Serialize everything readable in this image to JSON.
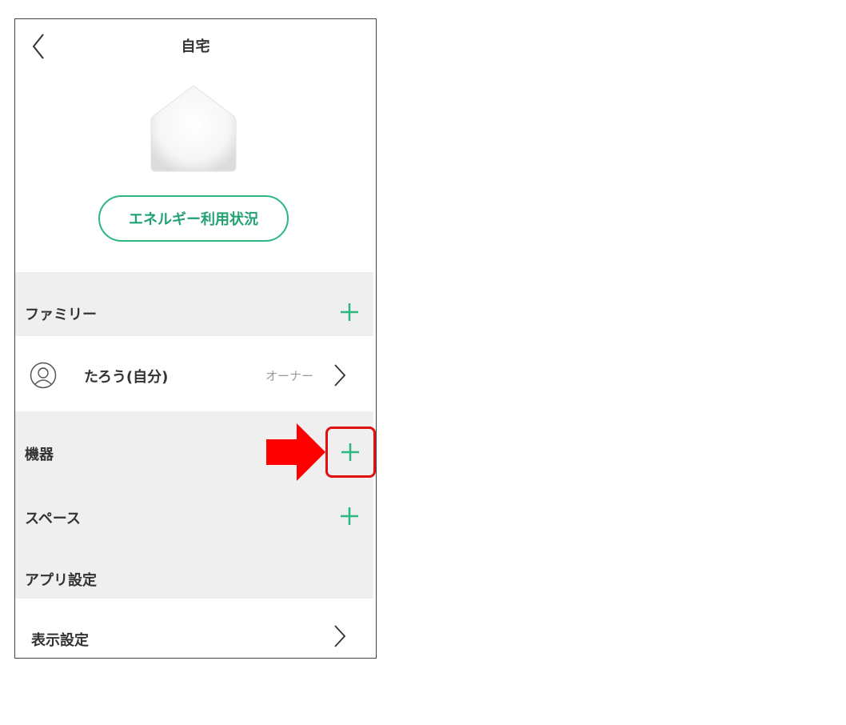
{
  "header": {
    "title": "自宅"
  },
  "energy_button": {
    "label": "エネルギー利用状況"
  },
  "family": {
    "title": "ファミリー",
    "member": {
      "name": "たろう(自分)",
      "role": "オーナー"
    }
  },
  "devices": {
    "title": "機器"
  },
  "spaces": {
    "title": "スペース"
  },
  "app_settings": {
    "title": "アプリ設定",
    "display": {
      "label": "表示設定"
    }
  },
  "colors": {
    "accent": "#2bb77f",
    "highlight": "#e01010",
    "section_bg": "#efefef"
  },
  "icons": [
    "back-chevron-icon",
    "house-icon",
    "plus-icon",
    "avatar-icon",
    "chevron-right-icon",
    "red-arrow-icon"
  ]
}
